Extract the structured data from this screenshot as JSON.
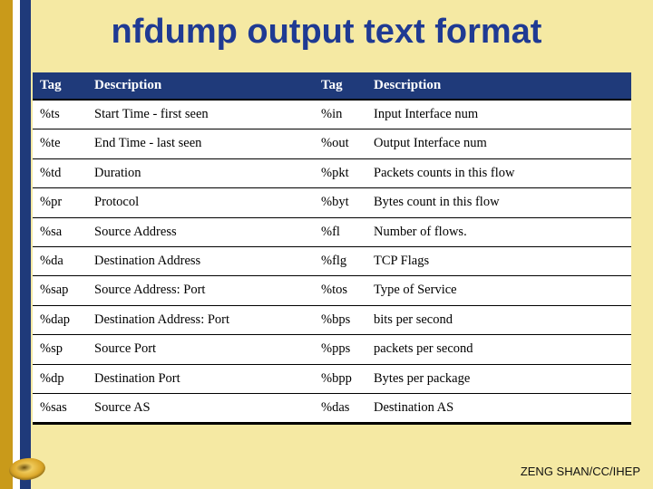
{
  "title": "nfdump output text format",
  "headers": {
    "tag1": "Tag",
    "desc1": "Description",
    "tag2": "Tag",
    "desc2": "Description"
  },
  "rows": [
    {
      "t1": "%ts",
      "d1": "Start Time - first seen",
      "t2": "%in",
      "d2": "Input Interface num"
    },
    {
      "t1": "%te",
      "d1": "End Time - last seen",
      "t2": "%out",
      "d2": "Output Interface num"
    },
    {
      "t1": "%td",
      "d1": "Duration",
      "t2": "%pkt",
      "d2": "Packets counts in this flow"
    },
    {
      "t1": "%pr",
      "d1": "Protocol",
      "t2": "%byt",
      "d2": "Bytes count in this flow"
    },
    {
      "t1": "%sa",
      "d1": "Source Address",
      "t2": "%fl",
      "d2": "Number of flows."
    },
    {
      "t1": "%da",
      "d1": "Destination Address",
      "t2": "%flg",
      "d2": "TCP Flags"
    },
    {
      "t1": "%sap",
      "d1": "Source Address: Port",
      "t2": "%tos",
      "d2": "Type of Service"
    },
    {
      "t1": "%dap",
      "d1": "Destination Address: Port",
      "t2": "%bps",
      "d2": "bits per second"
    },
    {
      "t1": "%sp",
      "d1": "Source Port",
      "t2": "%pps",
      "d2": "packets per second"
    },
    {
      "t1": "%dp",
      "d1": "Destination Port",
      "t2": "%bpp",
      "d2": "Bytes per package"
    },
    {
      "t1": "%sas",
      "d1": "Source AS",
      "t2": "%das",
      "d2": "Destination AS"
    }
  ],
  "footer": "ZENG SHAN/CC/IHEP"
}
